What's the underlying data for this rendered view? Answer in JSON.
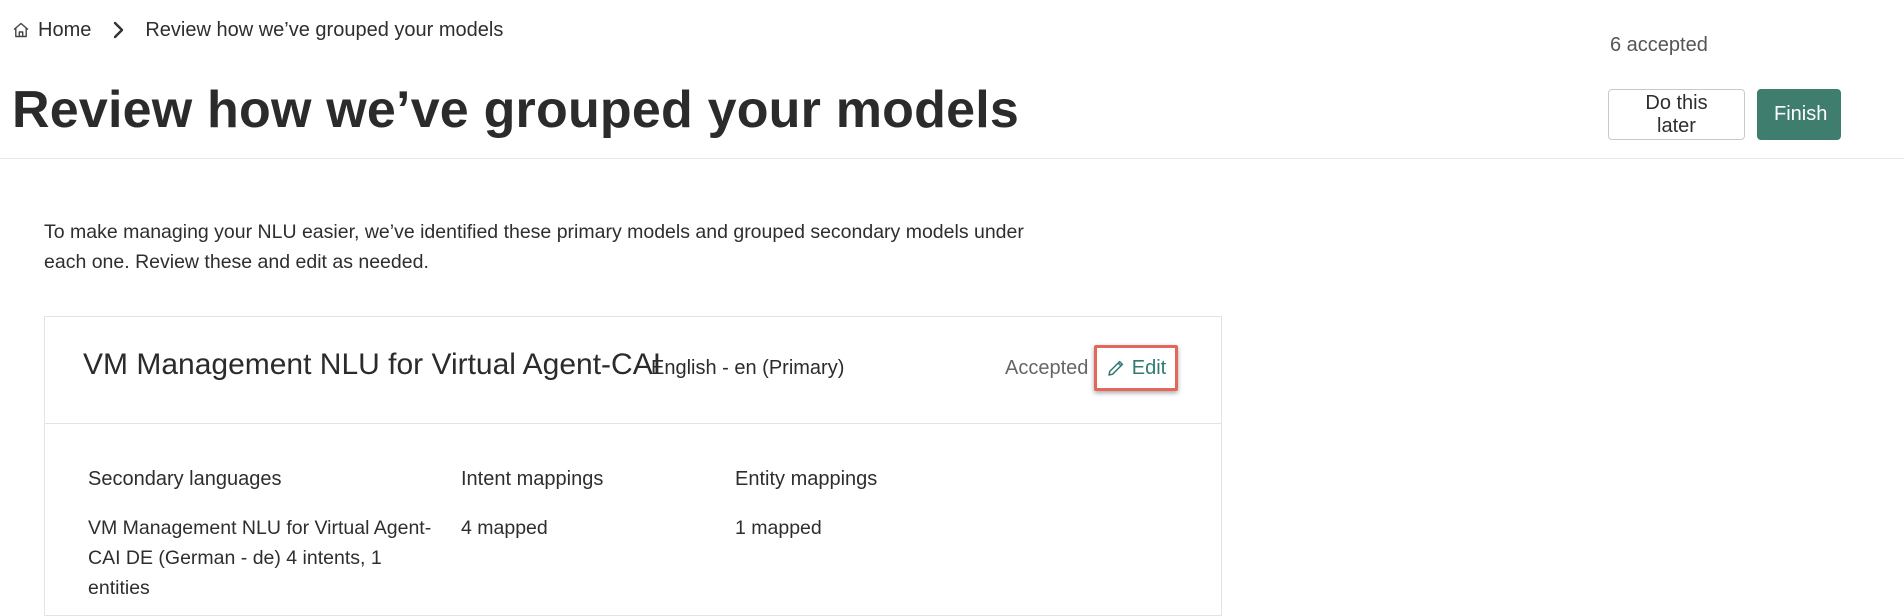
{
  "breadcrumb": {
    "home_label": "Home",
    "current_label": "Review how we’ve grouped your models"
  },
  "header": {
    "accepted_count": "6 accepted",
    "title": "Review how we’ve grouped your models",
    "do_later_label": "Do this later",
    "finish_label": "Finish"
  },
  "intro": {
    "text": "To make managing your NLU easier, we’ve identified these primary models and grouped secondary models under each one. Review these and edit as needed."
  },
  "model_card": {
    "name": "VM Management NLU for Virtual Agent-CAI",
    "language": "English - en (Primary)",
    "status": "Accepted",
    "edit_label": "Edit",
    "columns": {
      "secondary_languages": {
        "header": "Secondary languages",
        "value": "VM Management NLU for Virtual Agent-CAI DE (German - de) 4 intents, 1 entities"
      },
      "intent_mappings": {
        "header": "Intent mappings",
        "value": "4 mapped"
      },
      "entity_mappings": {
        "header": "Entity mappings",
        "value": "1 mapped"
      }
    }
  },
  "colors": {
    "primary": "#3f7e6f",
    "link": "#2f7a72",
    "highlight": "#e3685c"
  },
  "icons": {
    "home": "home-icon",
    "separator": "chevron-right-icon",
    "edit": "pencil-icon"
  }
}
